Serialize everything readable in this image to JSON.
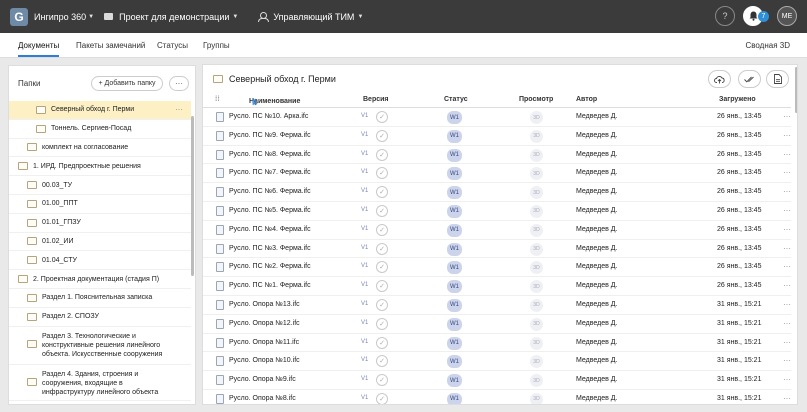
{
  "app": {
    "name": "Ингипро 360",
    "project": "Проект для демонстрации",
    "role": "Управляющий ТИМ"
  },
  "topbar": {
    "help_label": "?",
    "notif_count": "7",
    "avatar_initials": "ME"
  },
  "tabs": [
    "Документы",
    "Пакеты замечаний",
    "Статусы",
    "Группы"
  ],
  "summary3d_label": "Сводная 3D",
  "left_panel": {
    "title": "Папки",
    "add_folder_label": "+ Добавить папку",
    "more_label": "···",
    "folders": [
      {
        "label": "Северный обход г. Перми",
        "indent": 2,
        "selected": true,
        "dots": "···"
      },
      {
        "label": "Тоннель. Сергиев-Посад",
        "indent": 2,
        "selected": false,
        "dots": ""
      },
      {
        "label": "комплект на согласование",
        "indent": 1,
        "selected": false,
        "dots": ""
      },
      {
        "label": "1. ИРД. Предпроектные решения",
        "indent": 0,
        "selected": false,
        "dots": ""
      },
      {
        "label": "00.03_ТУ",
        "indent": 1,
        "selected": false,
        "dots": ""
      },
      {
        "label": "01.00_ППТ",
        "indent": 1,
        "selected": false,
        "dots": ""
      },
      {
        "label": "01.01_ГПЗУ",
        "indent": 1,
        "selected": false,
        "dots": ""
      },
      {
        "label": "01.02_ИИ",
        "indent": 1,
        "selected": false,
        "dots": ""
      },
      {
        "label": "01.04_СТУ",
        "indent": 1,
        "selected": false,
        "dots": ""
      },
      {
        "label": "2. Проектная документация (стадия П)",
        "indent": 0,
        "selected": false,
        "dots": ""
      },
      {
        "label": "Раздел 1. Пояснительная записка",
        "indent": 1,
        "selected": false,
        "dots": ""
      },
      {
        "label": "Раздел 2. СПОЗУ",
        "indent": 1,
        "selected": false,
        "dots": ""
      },
      {
        "label": "Раздел 3. Технологические и конструктивные решения линейного объекта. Искусственные сооружения",
        "indent": 1,
        "selected": false,
        "dots": "",
        "tall": true
      },
      {
        "label": "Раздел 4. Здания, строения и сооружения, входящие в инфраструктуру линейного объекта",
        "indent": 1,
        "selected": false,
        "dots": "",
        "tall": true
      }
    ]
  },
  "main": {
    "folder_title": "Северный обход г. Перми",
    "columns": {
      "name": "Наименование",
      "version": "Версия",
      "status": "Статус",
      "preview": "Просмотр",
      "author": "Автор",
      "uploaded": "Загружено"
    },
    "rows": [
      {
        "name": "Русло. ПС №10. Арка.ifc",
        "version": "V1",
        "status": "W1",
        "preview": "3D",
        "author": "Медведев Д.",
        "date": "26 янв., 13:45"
      },
      {
        "name": "Русло. ПС №9. Ферма.ifc",
        "version": "V1",
        "status": "W1",
        "preview": "3D",
        "author": "Медведев Д.",
        "date": "26 янв., 13:45"
      },
      {
        "name": "Русло. ПС №8. Ферма.ifc",
        "version": "V1",
        "status": "W1",
        "preview": "3D",
        "author": "Медведев Д.",
        "date": "26 янв., 13:45"
      },
      {
        "name": "Русло. ПС №7. Ферма.ifc",
        "version": "V1",
        "status": "W1",
        "preview": "3D",
        "author": "Медведев Д.",
        "date": "26 янв., 13:45"
      },
      {
        "name": "Русло. ПС №6. Ферма.ifc",
        "version": "V1",
        "status": "W1",
        "preview": "3D",
        "author": "Медведев Д.",
        "date": "26 янв., 13:45"
      },
      {
        "name": "Русло. ПС №5. Ферма.ifc",
        "version": "V1",
        "status": "W1",
        "preview": "3D",
        "author": "Медведев Д.",
        "date": "26 янв., 13:45"
      },
      {
        "name": "Русло. ПС №4. Ферма.ifc",
        "version": "V1",
        "status": "W1",
        "preview": "3D",
        "author": "Медведев Д.",
        "date": "26 янв., 13:45"
      },
      {
        "name": "Русло. ПС №3. Ферма.ifc",
        "version": "V1",
        "status": "W1",
        "preview": "3D",
        "author": "Медведев Д.",
        "date": "26 янв., 13:45"
      },
      {
        "name": "Русло. ПС №2. Ферма.ifc",
        "version": "V1",
        "status": "W1",
        "preview": "3D",
        "author": "Медведев Д.",
        "date": "26 янв., 13:45"
      },
      {
        "name": "Русло. ПС №1. Ферма.ifc",
        "version": "V1",
        "status": "W1",
        "preview": "3D",
        "author": "Медведев Д.",
        "date": "26 янв., 13:45"
      },
      {
        "name": "Русло. Опора №13.ifc",
        "version": "V1",
        "status": "W1",
        "preview": "3D",
        "author": "Медведев Д.",
        "date": "31 янв., 15:21"
      },
      {
        "name": "Русло. Опора №12.ifc",
        "version": "V1",
        "status": "W1",
        "preview": "3D",
        "author": "Медведев Д.",
        "date": "31 янв., 15:21"
      },
      {
        "name": "Русло. Опора №11.ifc",
        "version": "V1",
        "status": "W1",
        "preview": "3D",
        "author": "Медведев Д.",
        "date": "31 янв., 15:21"
      },
      {
        "name": "Русло. Опора №10.ifc",
        "version": "V1",
        "status": "W1",
        "preview": "3D",
        "author": "Медведев Д.",
        "date": "31 янв., 15:21"
      },
      {
        "name": "Русло. Опора №9.ifc",
        "version": "V1",
        "status": "W1",
        "preview": "3D",
        "author": "Медведев Д.",
        "date": "31 янв., 15:21"
      },
      {
        "name": "Русло. Опора №8.ifc",
        "version": "V1",
        "status": "W1",
        "preview": "3D",
        "author": "Медведев Д.",
        "date": "31 янв., 15:21"
      }
    ],
    "row_menu_label": "···"
  },
  "icons": {
    "logo": "ingipro-logo-icon",
    "bell": "bell-icon",
    "upload": "cloud-upload-icon",
    "check_all": "double-check-icon",
    "export": "document-export-icon"
  },
  "colors": {
    "topbar": "#3b3b3b",
    "accent": "#2d7fd3",
    "selected_row": "#fdf0c4",
    "status_badge": "#ccd4ec"
  }
}
